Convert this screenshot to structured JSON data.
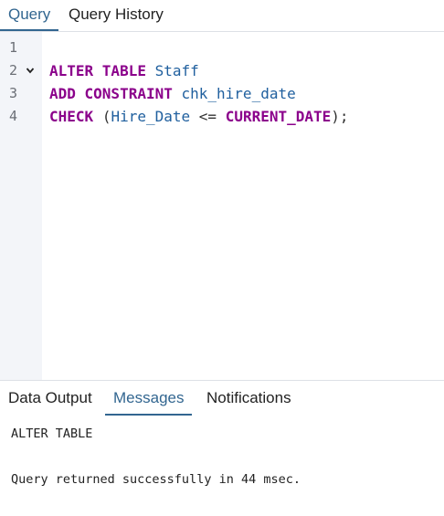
{
  "tabs": {
    "query": "Query",
    "history": "Query History"
  },
  "editor": {
    "line_numbers": [
      "1",
      "2",
      "3",
      "4"
    ],
    "fold_icon": "chevron-down-icon",
    "line2": {
      "kw1": "ALTER TABLE",
      "id1": "Staff"
    },
    "line3": {
      "kw1": "ADD CONSTRAINT",
      "id1": "chk_hire_date"
    },
    "line4": {
      "kw1": "CHECK",
      "p_open": "(",
      "id1": "Hire_Date",
      "op": "<=",
      "kw2": "CURRENT_DATE",
      "p_close": ");"
    }
  },
  "output_tabs": {
    "data_output": "Data Output",
    "messages": "Messages",
    "notifications": "Notifications"
  },
  "messages": {
    "line1": "ALTER TABLE",
    "line2": "Query returned successfully in 44 msec."
  },
  "colors": {
    "accent": "#326690",
    "keyword": "#8b008b",
    "identifier": "#1f5f9e",
    "gutter_bg": "#f3f5f9"
  }
}
